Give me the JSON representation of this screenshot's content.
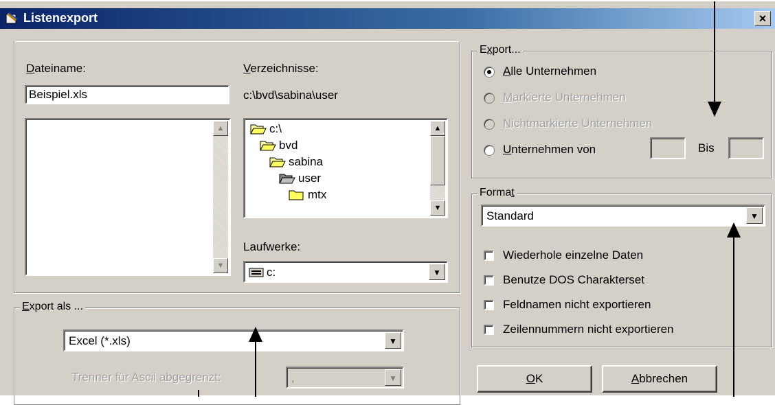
{
  "window": {
    "title": "Listenexport",
    "close_label": "×"
  },
  "file": {
    "name_label": "Dateiname:",
    "name_label_mnemonic": "D",
    "name_value": "Beispiel.xls",
    "dir_label": "Verzeichnisse:",
    "dir_label_mnemonic": "V",
    "dir_path": "c:\\bvd\\sabina\\user",
    "folders": [
      {
        "name": "c:\\",
        "indent": 0,
        "state": "open"
      },
      {
        "name": "bvd",
        "indent": 1,
        "state": "open"
      },
      {
        "name": "sabina",
        "indent": 2,
        "state": "open"
      },
      {
        "name": "user",
        "indent": 3,
        "state": "open-selected"
      },
      {
        "name": "mtx",
        "indent": 4,
        "state": "closed"
      }
    ],
    "drives_label": "Laufwerke:",
    "drive_value": "c:"
  },
  "export_range": {
    "legend": "Export...",
    "legend_mnemonic": "x",
    "options": [
      {
        "label": "Alle Unternehmen",
        "mnemonic": "A",
        "selected": true,
        "disabled": false
      },
      {
        "label": "Markierte Unternehmen",
        "mnemonic": "M",
        "selected": false,
        "disabled": true
      },
      {
        "label": "Nichtmarkierte Unternehmen",
        "mnemonic": "N",
        "selected": false,
        "disabled": true
      },
      {
        "label": "Unternehmen von",
        "mnemonic": "U",
        "selected": false,
        "disabled": false
      }
    ],
    "bis_label": "Bis",
    "from_value": "",
    "to_value": ""
  },
  "format": {
    "legend": "Format",
    "legend_mnemonic": "t",
    "selected": "Standard",
    "checkboxes": [
      {
        "label": "Wiederhole einzelne Daten",
        "checked": false
      },
      {
        "label": "Benutze DOS Charakterset",
        "checked": false
      },
      {
        "label": "Feldnamen nicht exportieren",
        "checked": false
      },
      {
        "label": "Zeilennummern nicht exportieren",
        "checked": false
      }
    ]
  },
  "export_as": {
    "legend": "Export als ...",
    "legend_mnemonic": "E",
    "selected": "Excel (*.xls)",
    "delimiter_label": "Trenner für Ascii abgegrenzt:",
    "delimiter_value": ","
  },
  "buttons": {
    "ok_label": "OK",
    "ok_mnemonic": "O",
    "cancel_label": "Abbrechen",
    "cancel_mnemonic": "A"
  },
  "colors": {
    "face": "#d4d0c8",
    "title_start": "#0a246a",
    "title_end": "#a6caf0",
    "disabled_text": "#a0a0a0"
  }
}
